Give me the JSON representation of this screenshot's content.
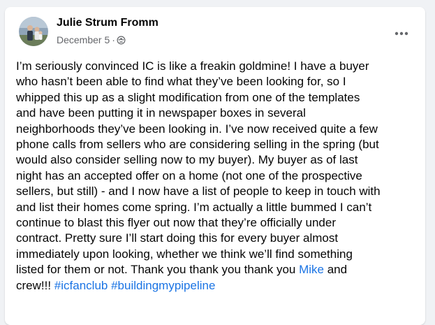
{
  "post": {
    "author": "Julie Strum Fromm",
    "date": "December 5",
    "separator": "·",
    "audience_icon": "group-icon",
    "more_icon": "more-horizontal-icon",
    "body_lines": [
      "I’m seriously convinced IC is like a freakin goldmine!  I have a buyer",
      "who hasn’t been able to find what they’ve been looking for, so I",
      "whipped this up as a slight modification from one of the templates",
      "and have been putting it in newspaper boxes in several",
      "neighborhoods they’ve been looking in. I’ve now received quite a few",
      "phone calls from sellers who are considering selling in the spring (but",
      "would also consider selling now to my buyer).  My buyer as of last",
      "night has an accepted offer on a home (not one of the prospective",
      "sellers, but still) - and I now have a list of people to keep in touch with",
      "and list their homes come spring.  I’m actually a little bummed I can’t",
      "continue to blast this flyer out now that they’re officially under",
      "contract. Pretty sure I’ll start doing this for every buyer almost",
      "immediately upon looking, whether we think we’ll find something"
    ],
    "line14_text": "listed for them or not. Thank you thank you thank you ",
    "mention": "Mike",
    "line14_after": " and",
    "line15_text": "crew!!!  ",
    "hashtag1": "#icfanclub",
    "hashtag_gap": " ",
    "hashtag2": "#buildingmypipeline"
  },
  "colors": {
    "text": "#050505",
    "secondary": "#65676b",
    "link": "#1b74e4",
    "background": "#f0f2f5",
    "card": "#ffffff"
  }
}
